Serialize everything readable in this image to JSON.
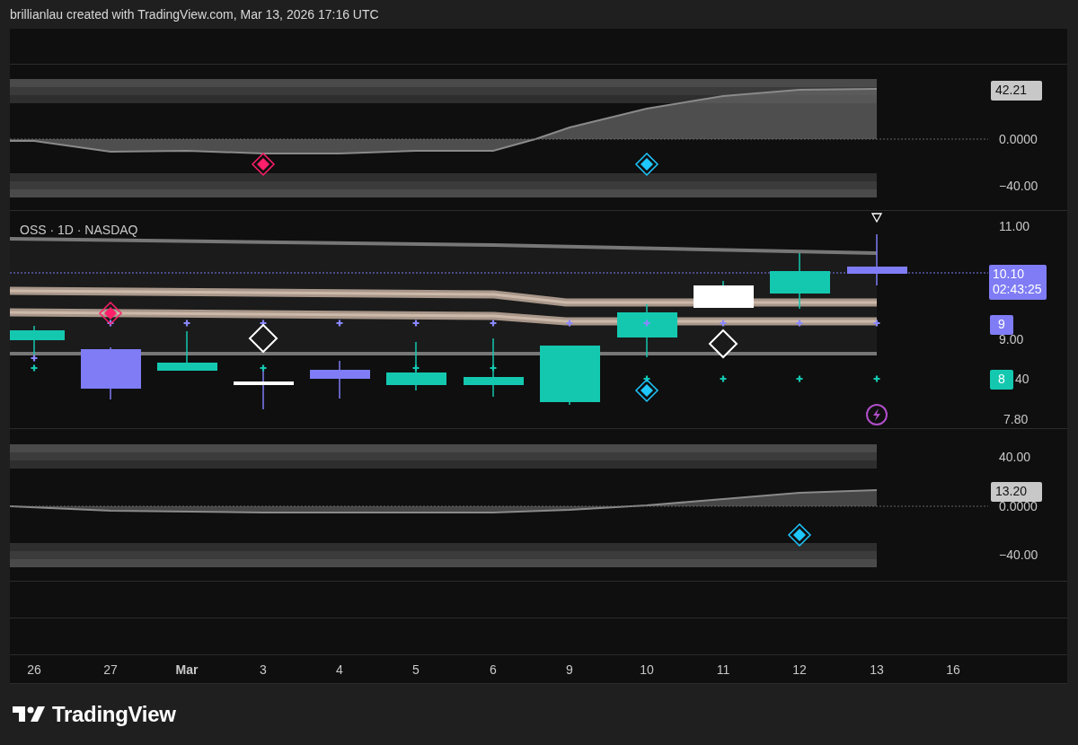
{
  "header": {
    "caption": "brillianlau created with TradingView.com, Mar 13, 2026 17:16 UTC"
  },
  "panes": [
    {
      "kind": "empty"
    },
    {
      "kind": "oscillator",
      "axis_labels": [
        "0.0000",
        "−40.00"
      ],
      "badges": [
        {
          "lines": [
            "42.21"
          ],
          "color": "#c8c8c8"
        }
      ]
    },
    {
      "kind": "price",
      "legend": "OSS · 1D · NASDAQ",
      "axis_labels": [
        "11.00",
        "9.00",
        "40",
        "7.80"
      ],
      "badges": [
        {
          "lines": [
            "10.10",
            "02:43:25"
          ],
          "color": "#7f7cf5"
        },
        {
          "lines": [
            "9"
          ],
          "color": "#7f7cf5"
        },
        {
          "lines": [
            "8"
          ],
          "color": "#14c8b0"
        }
      ]
    },
    {
      "kind": "oscillator",
      "axis_labels": [
        "40.00",
        "0.0000",
        "−40.00"
      ],
      "badges": [
        {
          "lines": [
            "13.20"
          ],
          "color": "#c8c8c8"
        }
      ]
    },
    {
      "kind": "empty"
    },
    {
      "kind": "empty"
    }
  ],
  "time_axis": [
    "26",
    "27",
    "Mar",
    "3",
    "4",
    "5",
    "6",
    "9",
    "10",
    "11",
    "12",
    "13",
    "16"
  ],
  "logo": {
    "text": "TradingView"
  }
}
